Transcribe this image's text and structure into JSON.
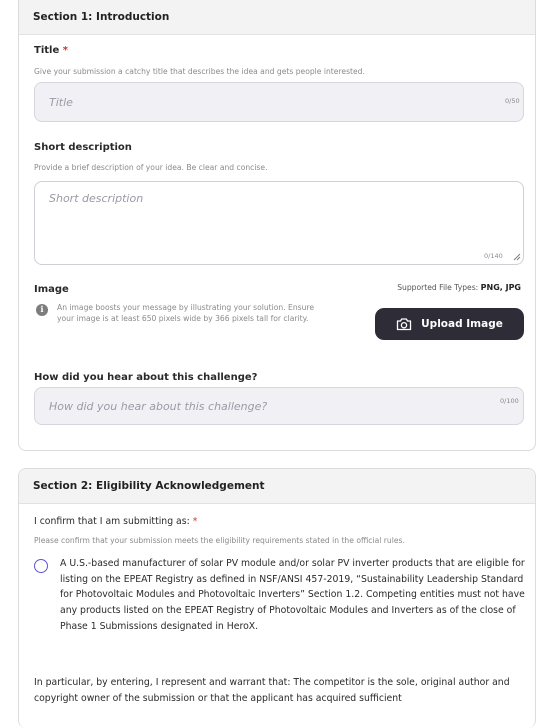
{
  "section1": {
    "header": "Section 1: Introduction",
    "title_field": {
      "label": "Title",
      "required_mark": "*",
      "hint": "Give your submission a catchy title that describes the idea and gets people interested.",
      "placeholder": "Title",
      "value": "",
      "counter": "0/50"
    },
    "short_description": {
      "label": "Short description",
      "hint": "Provide a brief description of your idea. Be clear and concise.",
      "placeholder": "Short description",
      "value": "",
      "counter": "0/140"
    },
    "image": {
      "label": "Image",
      "supported_prefix": "Supported File Types:",
      "supported_types": "PNG, JPG",
      "info_icon": "info-icon",
      "info_text": "An image boosts your message by illustrating your solution. Ensure your image is at least 650 pixels wide by 366 pixels tall for clarity.",
      "upload_label": "Upload Image",
      "upload_icon": "camera-icon"
    },
    "hear_about": {
      "label": "How did you hear about this challenge?",
      "placeholder": "How did you hear about this challenge?",
      "value": "",
      "counter": "0/100"
    }
  },
  "section2": {
    "header": "Section 2: Eligibility Acknowledgement",
    "confirm_label": "I confirm that I am submitting as:",
    "required_mark": "*",
    "confirm_hint": "Please confirm that your submission meets the eligibility requirements stated in the official rules.",
    "option_1": "A U.S.-based manufacturer of solar PV module and/or solar PV inverter products that are eligible for listing on the EPEAT Registry as defined in NSF/ANSI 457-2019, “Sustainability Leadership Standard for Photovoltaic Modules and Photovoltaic Inverters” Section 1.2. Competing entities must not have any products listed on the EPEAT Registry of Photovoltaic Modules and Inverters as of the close of Phase 1 Submissions designated in HeroX.",
    "warrant_text": "In particular, by entering, I represent and warrant that: The competitor is the sole, original author and copyright owner of the submission or that the applicant has acquired sufficient"
  },
  "colors": {
    "radio_accent": "#5b57d6",
    "button_bg": "#2e2c36",
    "required": "#c0392b"
  }
}
